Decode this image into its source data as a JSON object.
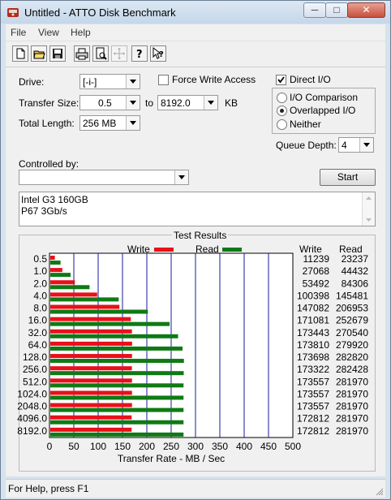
{
  "window": {
    "title": "Untitled - ATTO Disk Benchmark",
    "minimize": "─",
    "maximize": "□",
    "close": "✕"
  },
  "menu": [
    "File",
    "View",
    "Help"
  ],
  "toolbar": [
    "new-icon",
    "open-icon",
    "save-icon",
    "print-icon",
    "print-preview-icon",
    "move-icon",
    "help-icon",
    "context-help-icon"
  ],
  "settings": {
    "drive_label": "Drive:",
    "drive_value": "[-i-]",
    "force_write_label": "Force Write Access",
    "force_write_checked": false,
    "direct_io_label": "Direct I/O",
    "direct_io_checked": true,
    "transfer_size_label": "Transfer Size:",
    "transfer_from": "0.5",
    "to_label": "to",
    "transfer_to": "8192.0",
    "unit": "KB",
    "total_length_label": "Total Length:",
    "total_length_value": "256 MB",
    "io_comparison": "I/O Comparison",
    "overlapped_io": "Overlapped I/O",
    "neither": "Neither",
    "selected_mode": "overlapped",
    "queue_depth_label": "Queue Depth:",
    "queue_depth_value": "4",
    "controlled_by_label": "Controlled by:",
    "controlled_by_value": "",
    "start_label": "Start",
    "description": [
      "Intel G3 160GB",
      "P67 3Gb/s"
    ]
  },
  "results": {
    "title": "Test Results",
    "write_legend": "Write",
    "read_legend": "Read",
    "write_header": "Write",
    "read_header": "Read",
    "colors": {
      "write": "#e8101a",
      "read": "#0f7a14",
      "grid": "#1a1aa0"
    }
  },
  "chart_data": {
    "type": "bar",
    "xlabel": "Transfer Rate - MB / Sec",
    "xlim": [
      0,
      500
    ],
    "xticks": [
      "0",
      "50",
      "100",
      "150",
      "200",
      "250",
      "300",
      "350",
      "400",
      "450",
      "500"
    ],
    "categories": [
      "0.5",
      "1.0",
      "2.0",
      "4.0",
      "8.0",
      "16.0",
      "32.0",
      "64.0",
      "128.0",
      "256.0",
      "512.0",
      "1024.0",
      "2048.0",
      "4096.0",
      "8192.0"
    ],
    "series": [
      {
        "name": "Write",
        "values": [
          11.0,
          26.4,
          52.2,
          98.0,
          143.7,
          167.1,
          169.4,
          169.7,
          169.6,
          169.3,
          169.5,
          169.5,
          169.5,
          168.8,
          168.8
        ]
      },
      {
        "name": "Read",
        "values": [
          22.7,
          43.4,
          82.3,
          142.1,
          202.1,
          246.8,
          264.2,
          273.4,
          276.2,
          275.8,
          275.4,
          275.4,
          275.4,
          275.4,
          275.4
        ]
      }
    ],
    "write_kb": [
      "11239",
      "27068",
      "53492",
      "100398",
      "147082",
      "171081",
      "173443",
      "173810",
      "173698",
      "173322",
      "173557",
      "173557",
      "173557",
      "172812",
      "172812"
    ],
    "read_kb": [
      "23237",
      "44432",
      "84306",
      "145481",
      "206953",
      "252679",
      "270540",
      "279920",
      "282820",
      "282428",
      "281970",
      "281970",
      "281970",
      "281970",
      "281970"
    ]
  },
  "status": "For Help, press F1"
}
